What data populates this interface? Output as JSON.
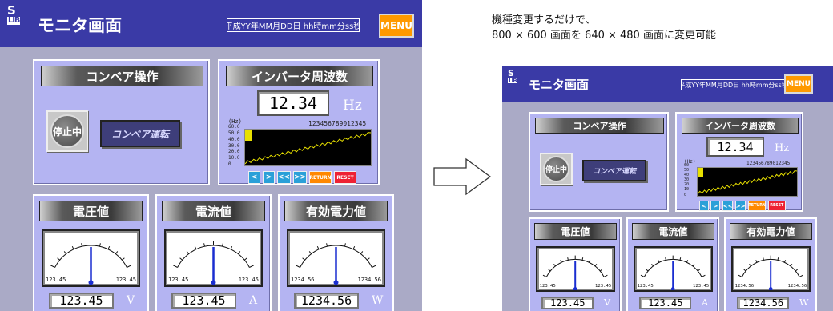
{
  "large": {
    "logo": {
      "s": "S",
      "l": "LIB"
    },
    "title": "モニタ画面",
    "date": "平成YY年MM月DD日 hh時mm分ss秒",
    "menu": "MENU",
    "conveyor": {
      "title": "コンベア操作",
      "stop": "停止中",
      "run": "コンベア運転"
    },
    "inverter": {
      "title": "インバータ周波数",
      "value": "12.34",
      "unit": "Hz",
      "graph_unit": "(Hz)",
      "ticks": [
        "60.0",
        "50.0",
        "40.0",
        "30.0",
        "20.0",
        "10.0",
        "0"
      ],
      "counter": "123456789012345"
    },
    "nav": [
      "<",
      ">",
      "<<",
      ">>",
      "RETURN",
      "RESET"
    ],
    "meters": [
      {
        "title": "電圧値",
        "min": "123.45",
        "max": "123.45",
        "value": "123.45",
        "unit": "V"
      },
      {
        "title": "電流値",
        "min": "123.45",
        "max": "123.45",
        "value": "123.45",
        "unit": "A"
      },
      {
        "title": "有効電力値",
        "min": "1234.56",
        "max": "1234.56",
        "value": "1234.56",
        "unit": "W"
      }
    ]
  },
  "caption": {
    "line1": "機種変更するだけで、",
    "line2": "800 × 600 画面を 640 × 480 画面に変更可能"
  },
  "arrow_icon": "right-arrow-icon",
  "small": {
    "logo": {
      "s": "S",
      "l": "LIB"
    },
    "title": "モニタ画面",
    "date": "平成YY年MM月DD日 hh時mm分ss秒",
    "menu": "MENU",
    "conveyor": {
      "title": "コンベア操作",
      "stop": "停止中",
      "run": "コンベア運転"
    },
    "inverter": {
      "title": "インバータ周波数",
      "value": "12.34",
      "unit": "Hz",
      "graph_unit": "(Hz)",
      "ticks": [
        "60.",
        "50.",
        "40.",
        "30.",
        "20.",
        "10.",
        "0"
      ],
      "counter": "123456789012345"
    },
    "nav": [
      "<",
      ">",
      "<<",
      ">>",
      "RETURN",
      "RESET"
    ],
    "meters": [
      {
        "title": "電圧値",
        "min": "123.45",
        "max": "123.45",
        "value": "123.45",
        "unit": "V"
      },
      {
        "title": "電流値",
        "min": "123.45",
        "max": "123.45",
        "value": "123.45",
        "unit": "A"
      },
      {
        "title": "有効電力値",
        "min": "1234.56",
        "max": "1234.56",
        "value": "1234.56",
        "unit": "W"
      }
    ]
  },
  "colors": {
    "header": "#3a3aa6",
    "panel": "#b4b4f2",
    "background": "#aaaac6",
    "menu": "#ff9900",
    "nav_blue": "#2aa0d8",
    "nav_orange": "#ff8800",
    "nav_red": "#ee2233",
    "needle": "#1a2ed0"
  }
}
